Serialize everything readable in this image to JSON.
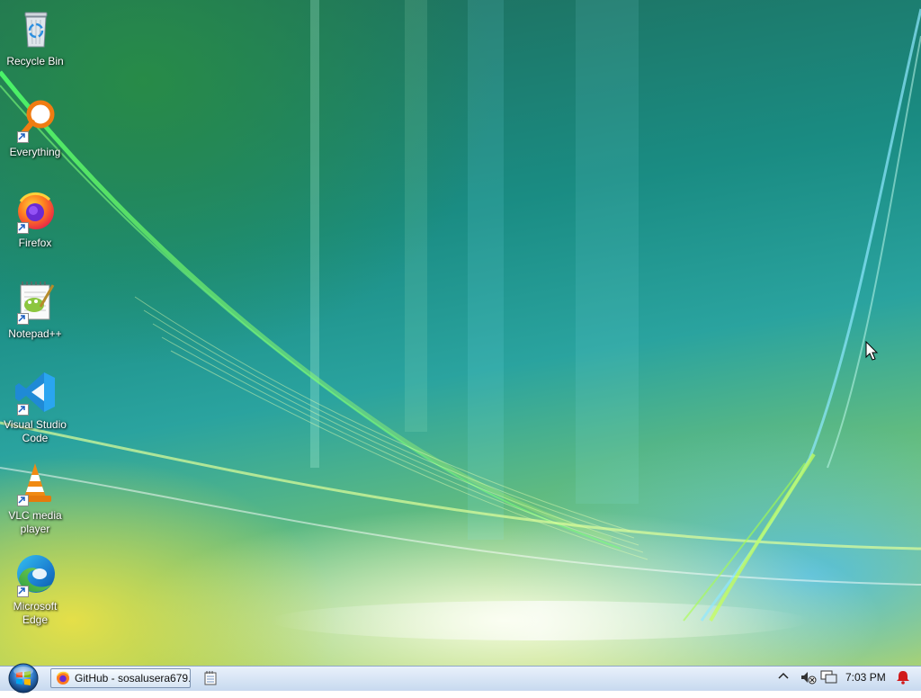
{
  "desktop": {
    "icons": [
      {
        "label": "Recycle Bin",
        "icon": "recycle-bin-icon",
        "shortcut": false
      },
      {
        "label": "Everything",
        "icon": "everything-search-icon",
        "shortcut": true
      },
      {
        "label": "Firefox",
        "icon": "firefox-icon",
        "shortcut": true
      },
      {
        "label": "Notepad++",
        "icon": "notepad-plus-plus-icon",
        "shortcut": true
      },
      {
        "label": "Visual Studio Code",
        "icon": "vscode-icon",
        "shortcut": true
      },
      {
        "label": "VLC media player",
        "icon": "vlc-icon",
        "shortcut": true
      },
      {
        "label": "Microsoft Edge",
        "icon": "edge-icon",
        "shortcut": true
      }
    ]
  },
  "taskbar": {
    "start_icon": "windows-start-orb-icon",
    "tasks": [
      {
        "label": "GitHub - sosalusera679...",
        "icon": "firefox-icon"
      },
      {
        "label": "",
        "icon": "notepad-icon"
      }
    ],
    "tray": {
      "icons": [
        "show-hidden-icons-chevron-icon",
        "sound-muted-icon",
        "network-icon",
        "notification-bell-icon"
      ],
      "clock": "7:03 PM"
    }
  },
  "colors": {
    "taskbar_top": "#e9f1fb",
    "taskbar_bottom": "#c7d9ef",
    "notification_red": "#d11a1a"
  }
}
